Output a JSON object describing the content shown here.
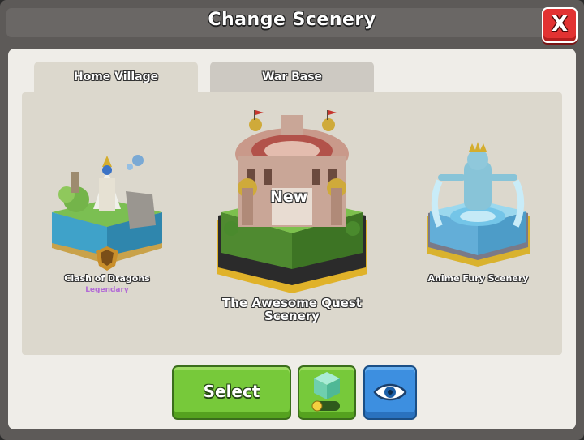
{
  "window": {
    "title": "Change Scenery",
    "close_label": "X"
  },
  "tabs": [
    {
      "label": "Home Village",
      "active": true
    },
    {
      "label": "War Base",
      "active": false
    }
  ],
  "sceneries": [
    {
      "name": "Clash of Dragons",
      "rarity": "Legendary"
    },
    {
      "name": "The Awesome Quest Scenery",
      "badge": "New"
    },
    {
      "name": "Anime Fury Scenery"
    }
  ],
  "actions": {
    "select_label": "Select",
    "toggle_icon": "cube-toggle-icon",
    "preview_icon": "eye-icon"
  },
  "colors": {
    "title_bar": "#6a6765",
    "close_red": "#e23232",
    "select_green": "#77c93a",
    "preview_blue": "#3d8fe0",
    "legendary_purple": "#b26ad6"
  }
}
